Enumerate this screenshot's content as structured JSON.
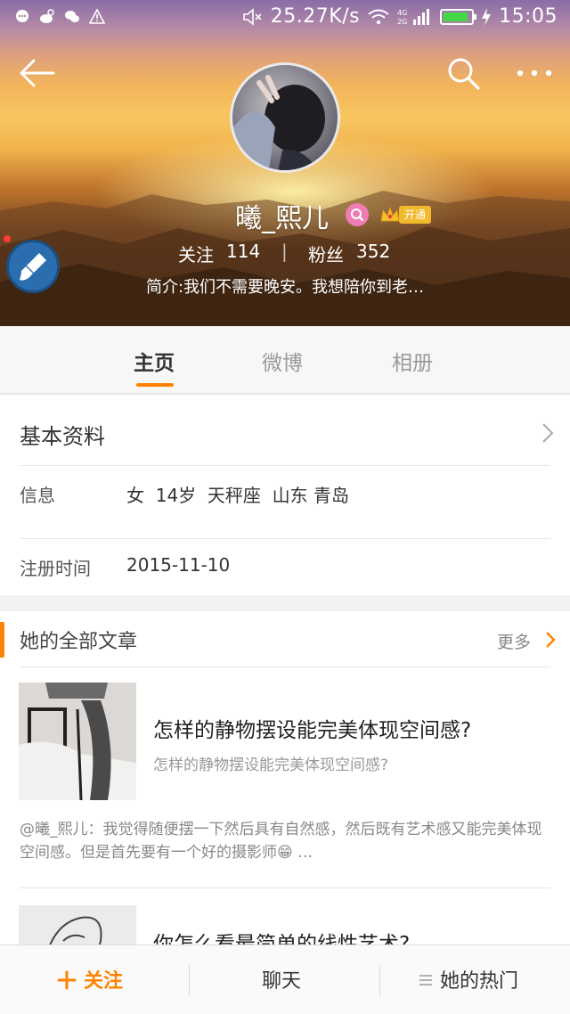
{
  "status_bar": {
    "network_speed": "25.27K/s",
    "signal_label": "4G 2G",
    "battery_level": 0.9,
    "time": "15:05"
  },
  "profile": {
    "nickname": "曦_熙儿",
    "vip_label": "开通",
    "following_label": "关注",
    "following_count": "114",
    "followers_label": "粉丝",
    "followers_count": "352",
    "bio": "简介:我们不需要晚安。我想陪你到老…"
  },
  "tabs": [
    {
      "label": "主页",
      "active": true
    },
    {
      "label": "微博",
      "active": false
    },
    {
      "label": "相册",
      "active": false
    }
  ],
  "basic_info": {
    "title": "基本资料",
    "info_label": "信息",
    "info_value": "女  14岁  天秤座  山东 青岛",
    "register_label": "注册时间",
    "register_value": "2015-11-10"
  },
  "articles": {
    "section_title": "她的全部文章",
    "more_label": "更多",
    "items": [
      {
        "headline": "怎样的静物摆设能完美体现空间感?",
        "subtitle": "怎样的静物摆设能完美体现空间感?",
        "excerpt": "@曦_熙儿：我觉得随便摆一下然后具有自然感，然后既有艺术感又能完美体现空间感。但是首先要有一个好的摄影师😁 …"
      },
      {
        "headline": "你怎么看最简单的线性艺术?"
      }
    ]
  },
  "bottom_bar": {
    "follow_label": "关注",
    "chat_label": "聊天",
    "hot_label": "她的热门"
  },
  "colors": {
    "accent": "#ff8200",
    "battery": "#43d843",
    "brush_button": "#2a6eb0"
  }
}
